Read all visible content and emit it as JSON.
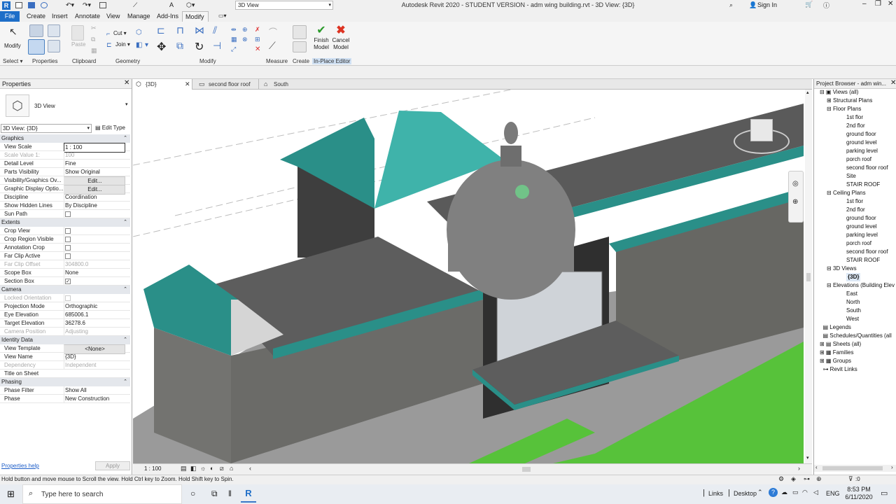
{
  "title_bar": {
    "app_title": "Autodesk Revit 2020 - STUDENT VERSION - adm wing building.rvt - 3D View: {3D}",
    "view_dropdown": "3D View",
    "sign_in": "Sign In"
  },
  "ribbon_tabs": [
    "File",
    "Create",
    "Insert",
    "Annotate",
    "View",
    "Manage",
    "Add-Ins",
    "Modify"
  ],
  "ribbon": {
    "modify_label": "Modify",
    "select_label": "Select",
    "cut_label": "Cut",
    "join_label": "Join",
    "paste_label": "Paste",
    "finish_label_1": "Finish",
    "finish_label_2": "Model",
    "cancel_label_1": "Cancel",
    "cancel_label_2": "Model",
    "panels": [
      "Properties",
      "Clipboard",
      "Geometry",
      "Modify",
      "Measure",
      "Create",
      "In-Place Editor"
    ]
  },
  "view_tabs": [
    {
      "label": "{3D}",
      "active": true
    },
    {
      "label": "second floor roof",
      "active": false
    },
    {
      "label": "South",
      "active": false
    }
  ],
  "properties": {
    "header": "Properties",
    "type_name": "3D View",
    "selector": "3D View: {3D}",
    "edit_type": "Edit Type",
    "sections": {
      "graphics": "Graphics",
      "extents": "Extents",
      "camera": "Camera",
      "identity": "Identity Data",
      "phasing": "Phasing"
    },
    "rows": {
      "view_scale": [
        "View Scale",
        "1 : 100"
      ],
      "scale_value": [
        "Scale Value    1:",
        "100"
      ],
      "detail_level": [
        "Detail Level",
        "Fine"
      ],
      "parts_visibility": [
        "Parts Visibility",
        "Show Original"
      ],
      "vg_overrides": [
        "Visibility/Graphics Ov...",
        "Edit..."
      ],
      "graphic_display": [
        "Graphic Display Optio...",
        "Edit..."
      ],
      "discipline": [
        "Discipline",
        "Coordination"
      ],
      "hidden_lines": [
        "Show Hidden Lines",
        "By Discipline"
      ],
      "sun_path": [
        "Sun Path",
        ""
      ],
      "crop_view": [
        "Crop View",
        ""
      ],
      "crop_region": [
        "Crop Region Visible",
        ""
      ],
      "annotation_crop": [
        "Annotation Crop",
        ""
      ],
      "far_clip_active": [
        "Far Clip Active",
        ""
      ],
      "far_clip_offset": [
        "Far Clip Offset",
        "304800.0"
      ],
      "scope_box": [
        "Scope Box",
        "None"
      ],
      "section_box": [
        "Section Box",
        "✓"
      ],
      "locked_orientation": [
        "Locked Orientation",
        ""
      ],
      "projection_mode": [
        "Projection Mode",
        "Orthographic"
      ],
      "eye_elevation": [
        "Eye Elevation",
        "685006.1"
      ],
      "target_elevation": [
        "Target Elevation",
        "36278.6"
      ],
      "camera_position": [
        "Camera Position",
        "Adjusting"
      ],
      "view_template": [
        "View Template",
        "<None>"
      ],
      "view_name": [
        "View Name",
        "{3D}"
      ],
      "dependency": [
        "Dependency",
        "Independent"
      ],
      "title_on_sheet": [
        "Title on Sheet",
        ""
      ],
      "phase_filter": [
        "Phase Filter",
        "Show All"
      ],
      "phase": [
        "Phase",
        "New Construction"
      ]
    },
    "help_link": "Properties help",
    "apply": "Apply"
  },
  "view_control_bar": {
    "scale": "1 : 100"
  },
  "project_browser": {
    "header": "Project Browser - adm win...",
    "items": [
      {
        "label": "Views (all)"
      },
      {
        "label": "Structural Plans"
      },
      {
        "label": "Floor Plans"
      },
      {
        "label": "1st flor"
      },
      {
        "label": "2nd flor"
      },
      {
        "label": "ground floor"
      },
      {
        "label": "ground level"
      },
      {
        "label": "parking level"
      },
      {
        "label": "porch roof"
      },
      {
        "label": "second floor roof"
      },
      {
        "label": "Site"
      },
      {
        "label": "STAIR ROOF"
      },
      {
        "label": "Ceiling Plans"
      },
      {
        "label": "1st flor"
      },
      {
        "label": "2nd flor"
      },
      {
        "label": "ground floor"
      },
      {
        "label": "ground level"
      },
      {
        "label": "parking level"
      },
      {
        "label": "porch roof"
      },
      {
        "label": "second floor roof"
      },
      {
        "label": "STAIR ROOF"
      },
      {
        "label": "3D Views"
      },
      {
        "label": "{3D}"
      },
      {
        "label": "Elevations (Building Elev"
      },
      {
        "label": "East"
      },
      {
        "label": "North"
      },
      {
        "label": "South"
      },
      {
        "label": "West"
      },
      {
        "label": "Legends"
      },
      {
        "label": "Schedules/Quantities (all"
      },
      {
        "label": "Sheets (all)"
      },
      {
        "label": "Families"
      },
      {
        "label": "Groups"
      },
      {
        "label": "Revit Links"
      }
    ]
  },
  "status_bar": {
    "message": "Hold button and move mouse to Scroll the view. Hold Ctrl key to Zoom. Hold Shift key to Spin.",
    "filter_count": ":0"
  },
  "taskbar": {
    "search_placeholder": "Type here to search",
    "links": "Links",
    "desktop": "Desktop",
    "lang": "ENG",
    "time": "8:53 PM",
    "date": "6/11/2020"
  },
  "colors": {
    "roof_teal": "#2a8f88",
    "roof_light": "#3fb3aa",
    "wall_stone": "#6b6b68",
    "slab_gray": "#5d5d5d",
    "grass": "#57c23a",
    "column_yellow": "#d4c050",
    "dome": "#808080",
    "file_tab_blue": "#1e6ec8"
  }
}
